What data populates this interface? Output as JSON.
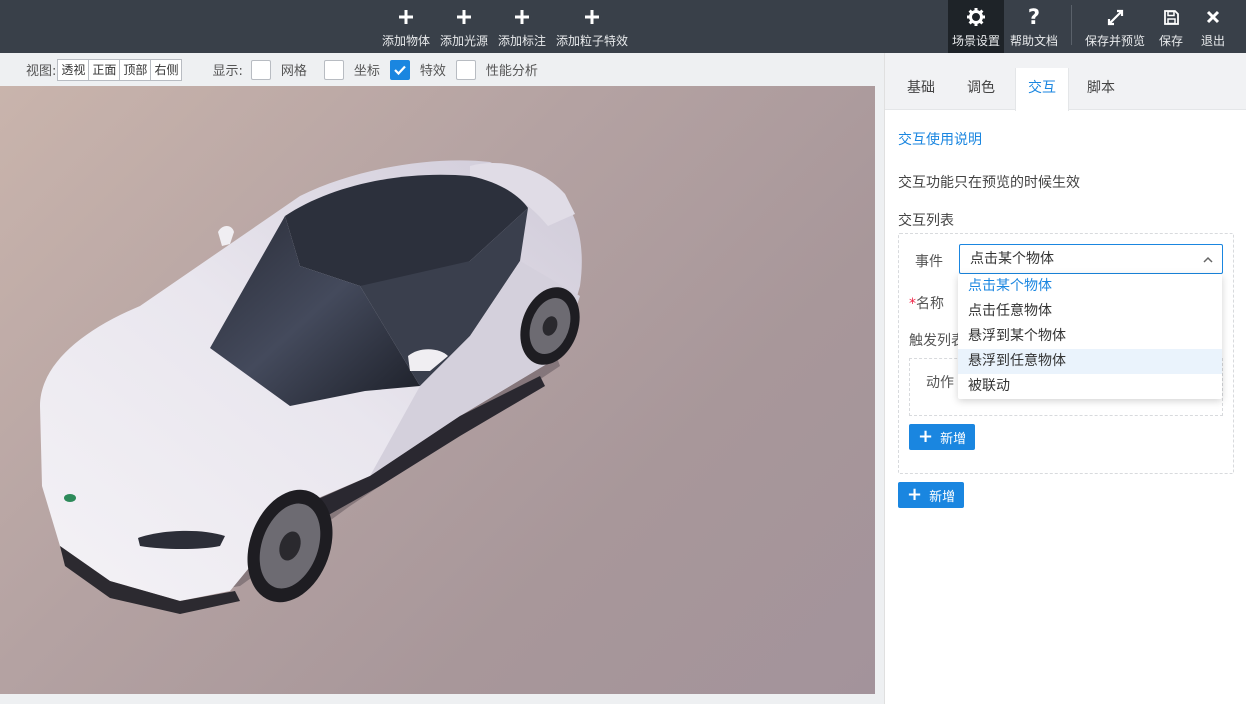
{
  "toolbar": {
    "add_object": "添加物体",
    "add_light": "添加光源",
    "add_label": "添加标注",
    "add_particle": "添加粒子特效",
    "scene_settings": "场景设置",
    "help_docs": "帮助文档",
    "save_preview": "保存并预览",
    "save": "保存",
    "exit": "退出"
  },
  "viewbar": {
    "view_label": "视图:",
    "views": [
      "透视",
      "正面",
      "顶部",
      "右侧"
    ],
    "display_label": "显示:",
    "options": [
      {
        "label": "网格",
        "checked": false
      },
      {
        "label": "坐标",
        "checked": false
      },
      {
        "label": "特效",
        "checked": true
      },
      {
        "label": "性能分析",
        "checked": false
      }
    ]
  },
  "panel": {
    "tabs": [
      "基础",
      "调色",
      "交互",
      "脚本"
    ],
    "active_tab": "交互",
    "help_link": "交互使用说明",
    "note": "交互功能只在预览的时候生效",
    "list_label": "交互列表",
    "event_label": "事件",
    "event_value": "点击某个物体",
    "name_label": "名称",
    "trigger_label": "触发列表",
    "action_label": "动作",
    "add_inner": "新增",
    "add_outer": "新增"
  },
  "dropdown": {
    "items": [
      "点击某个物体",
      "点击任意物体",
      "悬浮到某个物体",
      "悬浮到任意物体",
      "被联动"
    ],
    "selected": "点击某个物体",
    "hovered": "悬浮到任意物体"
  },
  "colors": {
    "accent": "#1a86e0",
    "toolbar_bg": "#394049"
  }
}
